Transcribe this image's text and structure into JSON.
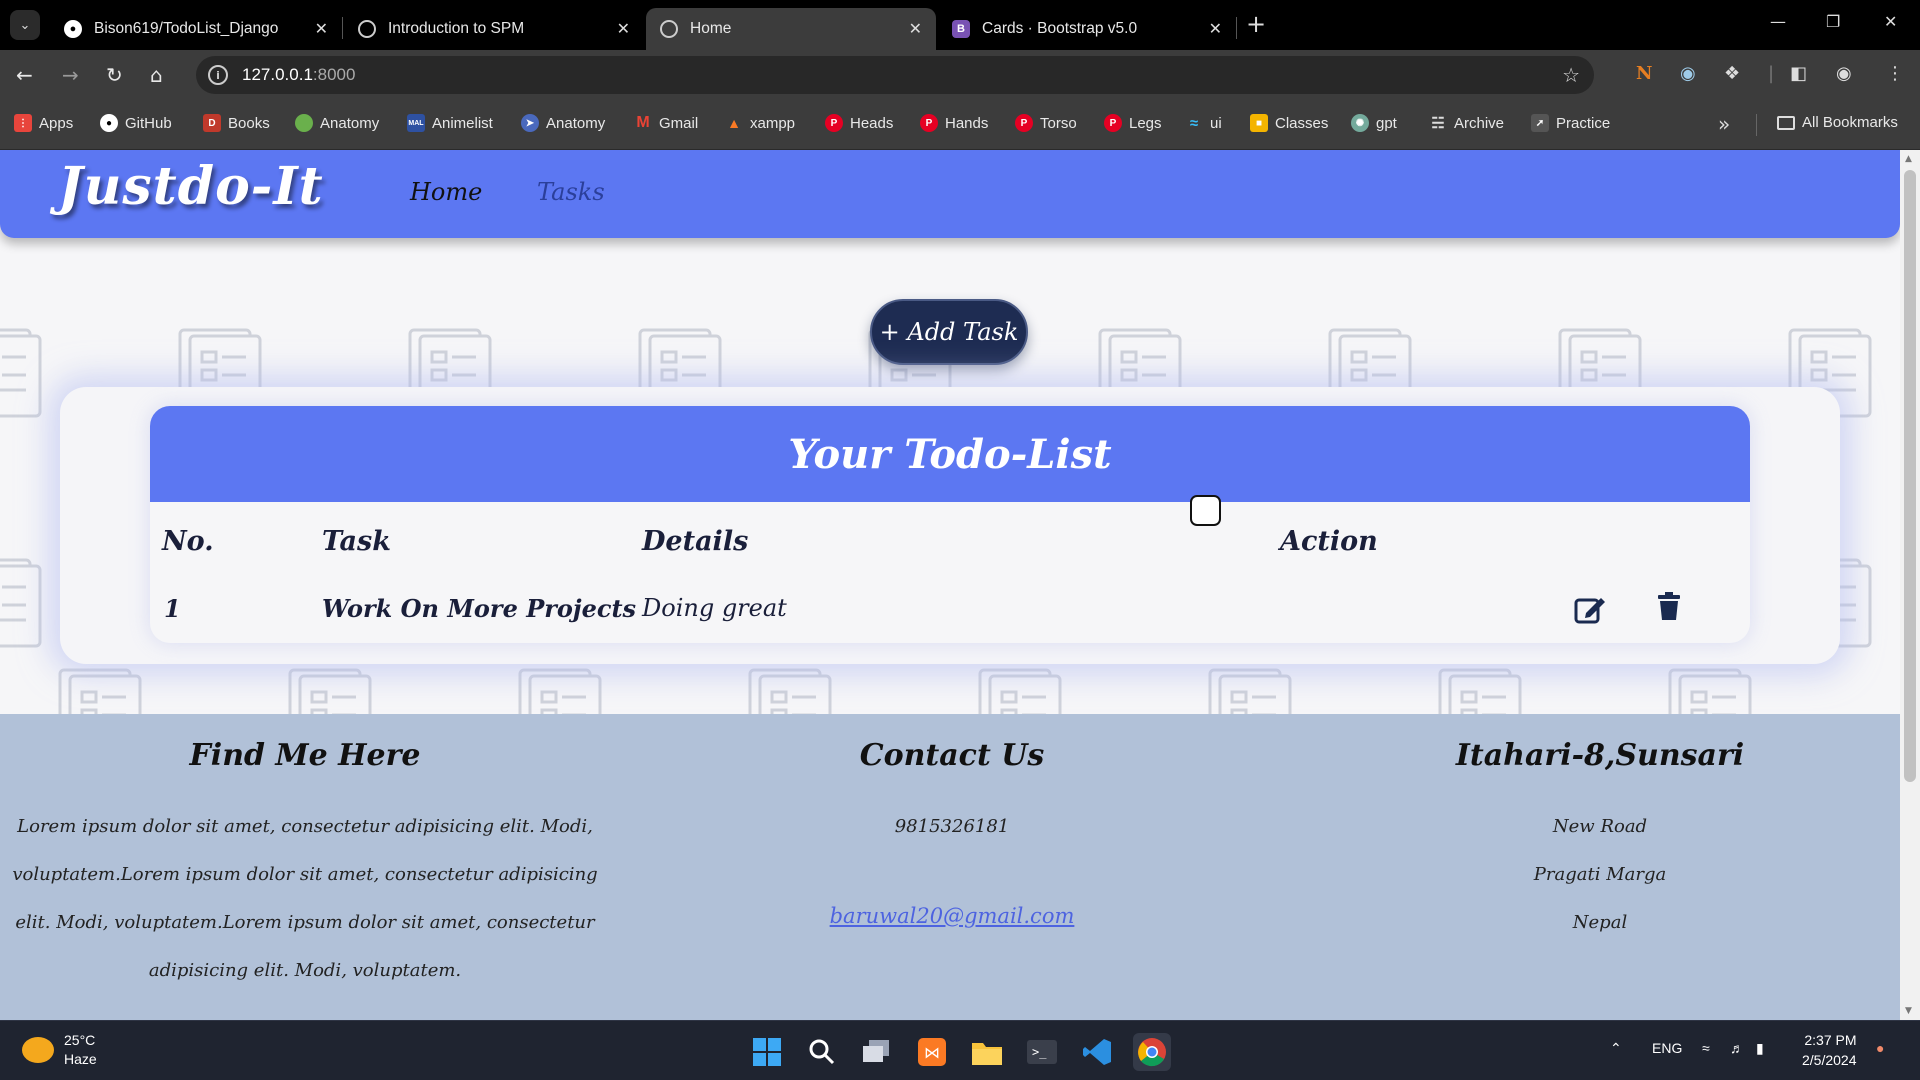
{
  "browser": {
    "tabs": [
      {
        "title": "Bison619/TodoList_Django",
        "icon": "github-icon"
      },
      {
        "title": "Introduction to SPM",
        "icon": "globe-icon"
      },
      {
        "title": "Home",
        "icon": "globe-icon",
        "active": true
      },
      {
        "title": "Cards · Bootstrap v5.0",
        "icon": "bootstrap-icon"
      }
    ],
    "url_host": "127.0.0.1",
    "url_port": ":8000",
    "bookmarks": [
      {
        "label": "Apps",
        "icon": "apps-grid-icon",
        "color": "#e8453c"
      },
      {
        "label": "GitHub",
        "icon": "github-icon",
        "color": "#ffffff"
      },
      {
        "label": "Books",
        "icon": "book-icon",
        "color": "#c0392b"
      },
      {
        "label": "Anatomy",
        "icon": "leaf-icon",
        "color": "#6ab04c"
      },
      {
        "label": "Animelist",
        "icon": "mal-icon",
        "color": "#2e51a2"
      },
      {
        "label": "Anatomy",
        "icon": "compass-icon",
        "color": "#4a69bd"
      },
      {
        "label": "Gmail",
        "icon": "gmail-icon",
        "color": "#ea4335"
      },
      {
        "label": "xampp",
        "icon": "xampp-icon",
        "color": "#fb7a24"
      },
      {
        "label": "Heads",
        "icon": "pinterest-icon",
        "color": "#e60023"
      },
      {
        "label": "Hands",
        "icon": "pinterest-icon",
        "color": "#e60023"
      },
      {
        "label": "Torso",
        "icon": "pinterest-icon",
        "color": "#e60023"
      },
      {
        "label": "Legs",
        "icon": "pinterest-icon",
        "color": "#e60023"
      },
      {
        "label": "ui",
        "icon": "tailwind-icon",
        "color": "#38bdf8"
      },
      {
        "label": "Classes",
        "icon": "classroom-icon",
        "color": "#f4b400"
      },
      {
        "label": "gpt",
        "icon": "openai-icon",
        "color": "#74aa9c"
      },
      {
        "label": "Archive",
        "icon": "archive-icon",
        "color": "#dddddd"
      },
      {
        "label": "Practice",
        "icon": "practice-icon",
        "color": "#555555"
      }
    ],
    "all_bookmarks": "All Bookmarks"
  },
  "site": {
    "brand": "Justdo-It",
    "nav": {
      "home": "Home",
      "tasks": "Tasks"
    },
    "add_task": "+ Add Task",
    "list_title": "Your Todo-List",
    "columns": {
      "no": "No.",
      "task": "Task",
      "details": "Details",
      "action": "Action"
    },
    "rows": [
      {
        "no": "1",
        "task": "Work On More Projects",
        "details": "Doing great",
        "done": false
      }
    ],
    "colors": {
      "primary": "#5c77f2",
      "button_dark": "#1e2c52",
      "footer_bg": "#b1c1d8"
    }
  },
  "footer": {
    "find_title": "Find Me Here",
    "find_text": "Lorem ipsum dolor sit amet, consectetur adipisicing elit. Modi, voluptatem.Lorem ipsum dolor sit amet, consectetur adipisicing elit. Modi, voluptatem.Lorem ipsum dolor sit amet, consectetur adipisicing elit. Modi, voluptatem.",
    "contact_title": "Contact Us",
    "phone": "9815326181",
    "email": "baruwal20@gmail.com",
    "address_title": "Itahari-8,Sunsari",
    "address_lines": [
      "New Road",
      "Pragati Marga",
      "Nepal"
    ]
  },
  "taskbar": {
    "temp": "25°C",
    "condition": "Haze",
    "lang": "ENG",
    "time": "2:37 PM",
    "date": "2/5/2024"
  }
}
